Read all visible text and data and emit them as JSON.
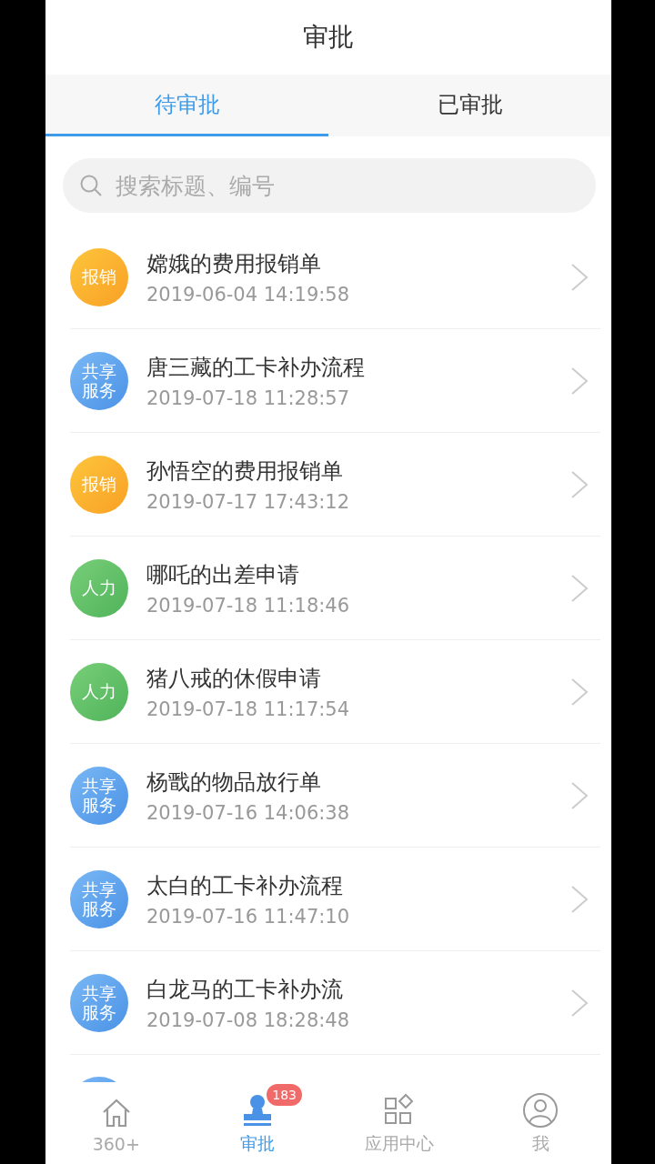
{
  "header": {
    "title": "审批"
  },
  "tabs": [
    {
      "label": "待审批",
      "selected": true
    },
    {
      "label": "已审批",
      "selected": false
    }
  ],
  "search": {
    "placeholder": "搜索标题、编号"
  },
  "items": [
    {
      "kind": "reimburse",
      "badge": "报销",
      "title": "嫦娥的费用报销单",
      "time": "2019-06-04 14:19:58"
    },
    {
      "kind": "shared",
      "badge": "共享服务",
      "title": "唐三藏的工卡补办流程",
      "time": "2019-07-18 11:28:57"
    },
    {
      "kind": "reimburse",
      "badge": "报销",
      "title": "孙悟空的费用报销单",
      "time": "2019-07-17 17:43:12"
    },
    {
      "kind": "hr",
      "badge": "人力",
      "title": "哪吒的出差申请",
      "time": "2019-07-18 11:18:46"
    },
    {
      "kind": "hr",
      "badge": "人力",
      "title": "猪八戒的休假申请",
      "time": "2019-07-18 11:17:54"
    },
    {
      "kind": "shared",
      "badge": "共享服务",
      "title": "杨戬的物品放行单",
      "time": "2019-07-16 14:06:38"
    },
    {
      "kind": "shared",
      "badge": "共享服务",
      "title": "太白的工卡补办流程",
      "time": "2019-07-16 11:47:10"
    },
    {
      "kind": "shared",
      "badge": "共享服务",
      "title": "白龙马的工卡补办流",
      "time": "2019-07-08 18:28:48"
    }
  ],
  "peek_item": {
    "kind": "shared"
  },
  "nav": [
    {
      "kind": "home",
      "label": "360+",
      "selected": false
    },
    {
      "kind": "stamp",
      "label": "审批",
      "selected": true,
      "badge": "183"
    },
    {
      "kind": "apps",
      "label": "应用中心",
      "selected": false
    },
    {
      "kind": "user",
      "label": "我",
      "selected": false
    }
  ]
}
